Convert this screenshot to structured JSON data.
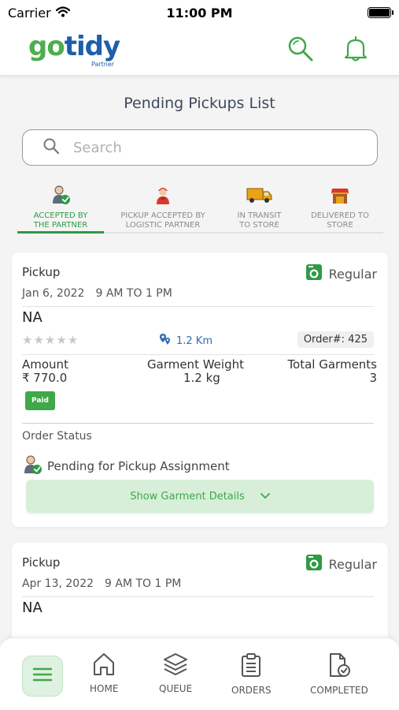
{
  "status_bar": {
    "carrier": "Carrier",
    "time": "11:00 PM"
  },
  "header": {
    "logo_text_g": "go",
    "logo_text_rest": "tidy",
    "logo_subtitle": "Partner"
  },
  "page": {
    "title": "Pending Pickups List"
  },
  "search": {
    "placeholder": "Search",
    "value": ""
  },
  "tabs": [
    {
      "line1": "ACCEPTED BY",
      "line2": "THE PARTNER",
      "active": true,
      "icon": "partner-check-icon"
    },
    {
      "line1": "PICKUP ACCEPTED BY",
      "line2": "LOGISTIC PARTNER",
      "active": false,
      "icon": "delivery-person-icon"
    },
    {
      "line1": "IN TRANSIT",
      "line2": "TO STORE",
      "active": false,
      "icon": "truck-icon"
    },
    {
      "line1": "DELIVERED TO",
      "line2": "STORE",
      "active": false,
      "icon": "store-icon"
    }
  ],
  "orders": [
    {
      "type": "Pickup",
      "service": "Regular",
      "date": "Jan 6, 2022",
      "slot": "9 AM TO 1 PM",
      "name": "NA",
      "stars": "★★★★★",
      "distance": "1.2 Km",
      "order_no": "Order#: 425",
      "amount_label": "Amount",
      "amount": "₹ 770.0",
      "weight_label": "Garment Weight",
      "weight": "1.2 kg",
      "garments_label": "Total Garments",
      "garments": "3",
      "payment": "Paid",
      "status_label": "Order Status",
      "status": "Pending for Pickup Assignment",
      "details_button": "Show Garment Details"
    },
    {
      "type": "Pickup",
      "service": "Regular",
      "date": "Apr 13, 2022",
      "slot": "9 AM TO 1 PM",
      "name": "NA"
    }
  ],
  "bottom_nav": {
    "items": [
      {
        "label": "HOME",
        "icon": "home-icon"
      },
      {
        "label": "QUEUE",
        "icon": "layers-icon"
      },
      {
        "label": "ORDERS",
        "icon": "clipboard-icon"
      },
      {
        "label": "COMPLETED",
        "icon": "document-check-icon"
      }
    ]
  },
  "colors": {
    "brand_green": "#3fa84a",
    "brand_blue": "#1d5fa8",
    "active_tab": "#2f9a45"
  }
}
